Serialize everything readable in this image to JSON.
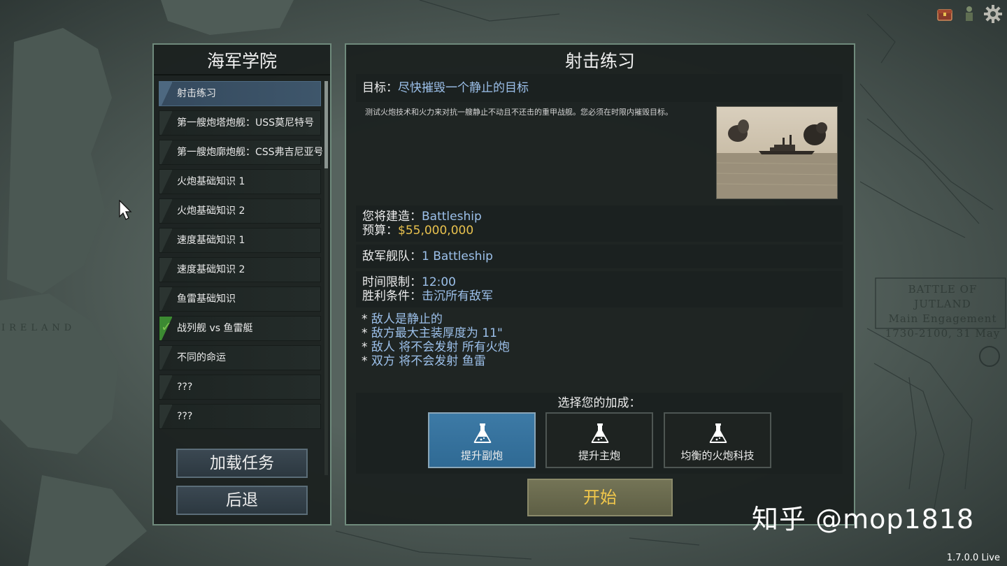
{
  "academy": {
    "title": "海军学院",
    "missions": [
      {
        "label": "射击练习",
        "state": "active"
      },
      {
        "label": "第一艘炮塔炮舰：USS莫尼特号",
        "state": "normal"
      },
      {
        "label": "第一艘炮廓炮舰：CSS弗吉尼亚号",
        "state": "normal"
      },
      {
        "label": "火炮基础知识 1",
        "state": "normal"
      },
      {
        "label": "火炮基础知识 2",
        "state": "normal"
      },
      {
        "label": "速度基础知识 1",
        "state": "normal"
      },
      {
        "label": "速度基础知识 2",
        "state": "normal"
      },
      {
        "label": "鱼雷基础知识",
        "state": "normal"
      },
      {
        "label": "战列舰 vs 鱼雷艇",
        "state": "done"
      },
      {
        "label": "不同的命运",
        "state": "normal"
      },
      {
        "label": "???",
        "state": "normal"
      },
      {
        "label": "???",
        "state": "normal"
      }
    ],
    "load_button": "加载任务",
    "back_button": "后退"
  },
  "mission": {
    "title": "射击练习",
    "objective_label": "目标：",
    "objective_value": "尽快摧毁一个静止的目标",
    "description": "测试火炮技术和火力来对抗一艘静止不动且不还击的重甲战舰。您必须在时限内摧毁目标。",
    "build_label": "您将建造：",
    "build_value": "Battleship",
    "budget_label": "预算：",
    "budget_value": "$55,000,000",
    "fleet_label": "敌军舰队：",
    "fleet_value": "1 Battleship",
    "time_label": "时间限制：",
    "time_value": "12:00",
    "victory_label": "胜利条件：",
    "victory_value": "击沉所有敌军",
    "notes": [
      "敌人是静止的",
      "敌方最大主装厚度为 11\"",
      "敌人 将不会发射 所有火炮",
      "双方 将不会发射 鱼雷"
    ],
    "bonus_title": "选择您的加成：",
    "bonuses": [
      {
        "label": "提升副炮",
        "selected": true
      },
      {
        "label": "提升主炮",
        "selected": false
      },
      {
        "label": "均衡的火炮科技",
        "selected": false
      }
    ],
    "start_button": "开始"
  },
  "map": {
    "jutland_line1": "BATTLE OF JUTLAND",
    "jutland_line2": "Main Engagement",
    "jutland_line3": "1730-2100, 31 May",
    "ireland": "IRELAND"
  },
  "icons": [
    "chest-icon",
    "soldier-icon",
    "gear-icon",
    "flask-icon",
    "cursor-icon"
  ],
  "watermark": "知乎 @mop1818",
  "version": "1.7.0.0 Live",
  "colors": {
    "accent_blue": "#9cc0ea",
    "gold": "#e9c24e",
    "panel_border": "#6f8a7c",
    "selected_bonus": "#3d7aa6",
    "done_check": "#7ec14f"
  }
}
